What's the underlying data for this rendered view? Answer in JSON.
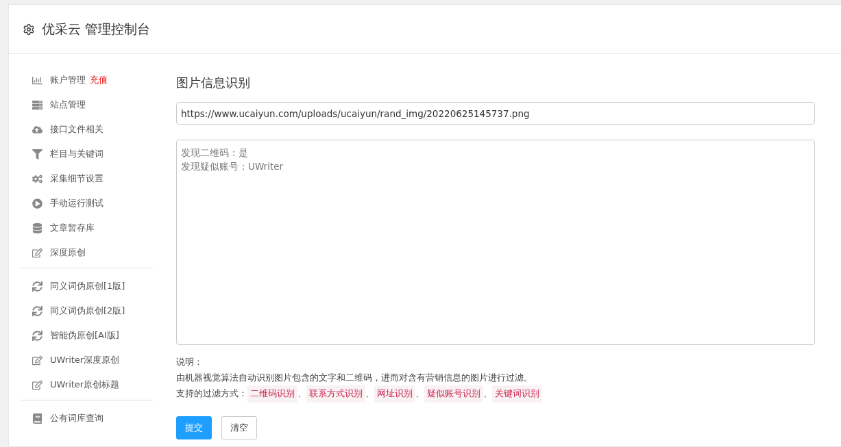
{
  "header": {
    "title": "优采云 管理控制台"
  },
  "sidebar": {
    "groups": [
      [
        {
          "label": "账户管理",
          "badge": "充值"
        },
        {
          "label": "站点管理"
        },
        {
          "label": "接口文件相关"
        },
        {
          "label": "栏目与关键词"
        },
        {
          "label": "采集细节设置"
        },
        {
          "label": "手动运行测试"
        },
        {
          "label": "文章暂存库"
        },
        {
          "label": "深度原创"
        }
      ],
      [
        {
          "label": "同义词伪原创[1版]"
        },
        {
          "label": "同义词伪原创[2版]"
        },
        {
          "label": "智能伪原创[AI版]"
        },
        {
          "label": "UWriter深度原创"
        },
        {
          "label": "UWriter原创标题"
        }
      ],
      [
        {
          "label": "公有词库查询"
        }
      ]
    ]
  },
  "main": {
    "title": "图片信息识别",
    "url_field": {
      "value": "https://www.ucaiyun.com/uploads/ucaiyun/rand_img/20220625145737.png"
    },
    "result_field": {
      "lines": [
        "发现二维码：是",
        "发现疑似账号：UWriter"
      ]
    },
    "notes_label": "说明：",
    "description": "由机器视觉算法自动识别图片包含的文字和二维码，进而对含有营销信息的图片进行过滤。",
    "filters_label": "支持的过滤方式：",
    "filters": [
      "二维码识别",
      "联系方式识别",
      "网址识别",
      "疑似账号识别",
      "关键词识别"
    ],
    "separator": "、",
    "buttons": [
      {
        "label": "提交",
        "kind": "primary"
      },
      {
        "label": "清空",
        "kind": "default"
      }
    ]
  }
}
